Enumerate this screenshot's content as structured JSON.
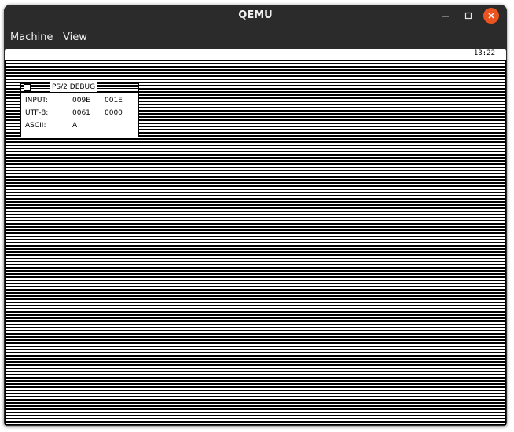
{
  "window": {
    "title": "QEMU",
    "controls": {
      "minimize_icon": "minimize-icon",
      "maximize_icon": "maximize-icon",
      "close_icon": "close-icon",
      "close_color": "#e95420"
    }
  },
  "menubar": {
    "items": [
      {
        "label": "Machine"
      },
      {
        "label": "View"
      }
    ]
  },
  "guest": {
    "clock": "13:22",
    "debug_window": {
      "title": "PS/2 DEBUG",
      "rows": [
        {
          "label": "INPUT:",
          "v1": "009E",
          "v2": "001E"
        },
        {
          "label": "UTF-8:",
          "v1": "0061",
          "v2": "0000"
        },
        {
          "label": "ASCII:",
          "v1": "A",
          "v2": ""
        }
      ]
    }
  }
}
